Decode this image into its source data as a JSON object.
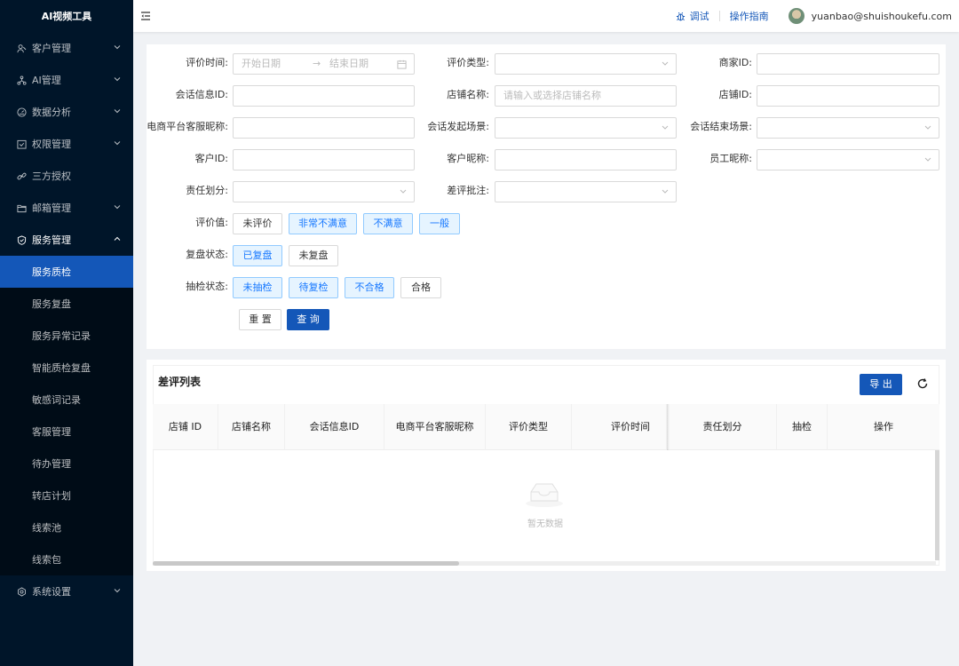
{
  "app": {
    "title": "AI视频工具"
  },
  "sidebar": {
    "menus": [
      {
        "label": "客户管理",
        "icon": "customer-icon"
      },
      {
        "label": "AI管理",
        "icon": "ai-icon"
      },
      {
        "label": "数据分析",
        "icon": "dashboard-icon"
      },
      {
        "label": "权限管理",
        "icon": "permission-icon"
      },
      {
        "label": "三方授权",
        "icon": "link-icon"
      },
      {
        "label": "邮箱管理",
        "icon": "folder-icon"
      },
      {
        "label": "服务管理",
        "icon": "shield-icon"
      },
      {
        "label": "系统设置",
        "icon": "settings-icon"
      }
    ],
    "sub_items": [
      {
        "label": "服务质检"
      },
      {
        "label": "服务复盘"
      },
      {
        "label": "服务异常记录"
      },
      {
        "label": "智能质检复盘"
      },
      {
        "label": "敏感词记录"
      },
      {
        "label": "客服管理"
      },
      {
        "label": "待办管理"
      },
      {
        "label": "转店计划"
      },
      {
        "label": "线索池"
      },
      {
        "label": "线索包"
      }
    ],
    "active_sub": "服务质检"
  },
  "header": {
    "debug_label": "调试",
    "guide_label": "操作指南",
    "user_email": "yuanbao@shuishoukefu.com"
  },
  "filters": {
    "eval_time_label": "评价时间:",
    "start_placeholder": "开始日期",
    "end_placeholder": "结束日期",
    "eval_type_label": "评价类型:",
    "merchant_id_label": "商家ID:",
    "session_id_label": "会话信息ID:",
    "shop_name_label": "店铺名称:",
    "shop_name_placeholder": "请输入或选择店铺名称",
    "shop_id_label": "店铺ID:",
    "platform_nick_label": "电商平台客服昵称:",
    "session_start_label": "会话发起场景:",
    "session_end_label": "会话结束场景:",
    "customer_id_label": "客户ID:",
    "customer_nick_label": "客户昵称:",
    "staff_nick_label": "员工昵称:",
    "responsibility_label": "责任划分:",
    "bad_review_note_label": "差评批注:",
    "eval_value_label": "评价值:",
    "eval_value_options": [
      "未评价",
      "非常不满意",
      "不满意",
      "一般"
    ],
    "review_status_label": "复盘状态:",
    "review_status_options": [
      "已复盘",
      "未复盘"
    ],
    "sample_status_label": "抽检状态:",
    "sample_status_options": [
      "未抽检",
      "待复检",
      "不合格",
      "合格"
    ],
    "reset_label": "重 置",
    "query_label": "查 询"
  },
  "table": {
    "title": "差评列表",
    "export_label": "导 出",
    "columns": [
      "店铺 ID",
      "店铺名称",
      "会话信息ID",
      "电商平台客服昵称",
      "评价类型",
      "评价时间",
      "责任划分",
      "抽检",
      "操作"
    ],
    "empty_text": "暂无数据"
  },
  "colors": {
    "sidebar_bg": "#001529",
    "accent": "#1457b8",
    "selected_chip_bg": "#e6f4ff"
  }
}
